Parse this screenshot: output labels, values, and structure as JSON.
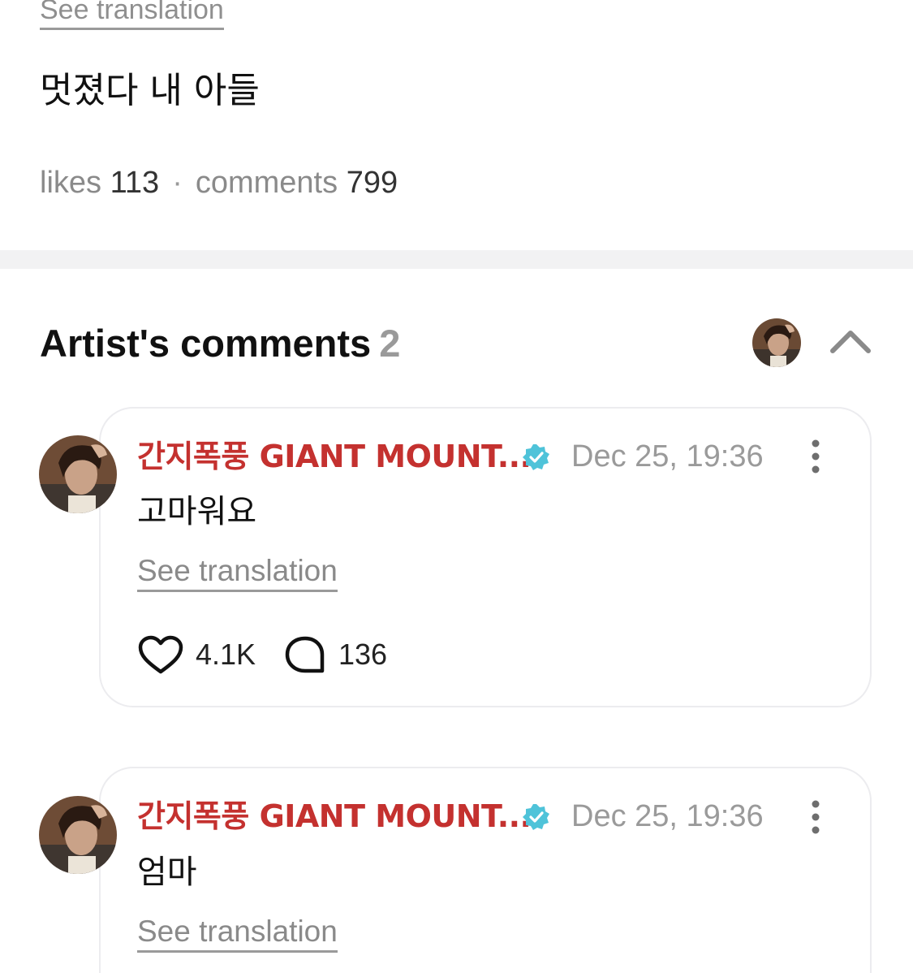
{
  "post": {
    "translate_label": "See translation",
    "body": "멋졌다 내 아들",
    "likes_label": "likes",
    "likes_count": "113",
    "separator": "·",
    "comments_label": "comments",
    "comments_count": "799"
  },
  "artist_comments": {
    "title": "Artist's comments",
    "count": "2",
    "collapse_icon": "chevron-up-icon",
    "comments": [
      {
        "author": "간지폭풍 GIANT MOUNT...",
        "verified_icon": "verified-badge-icon",
        "date": "Dec 25, 19:36",
        "text": "고마워요",
        "translate_label": "See translation",
        "likes": "4.1K",
        "replies": "136"
      },
      {
        "author": "간지폭풍 GIANT MOUNT...",
        "verified_icon": "verified-badge-icon",
        "date": "Dec 25, 19:36",
        "text": "엄마",
        "translate_label": "See translation"
      }
    ]
  },
  "colors": {
    "author_name": "#c4312f",
    "verified_badge": "#4fc3d9",
    "muted_text": "#9a9a9a",
    "divider": "#f2f2f3",
    "card_border": "#ececef"
  }
}
